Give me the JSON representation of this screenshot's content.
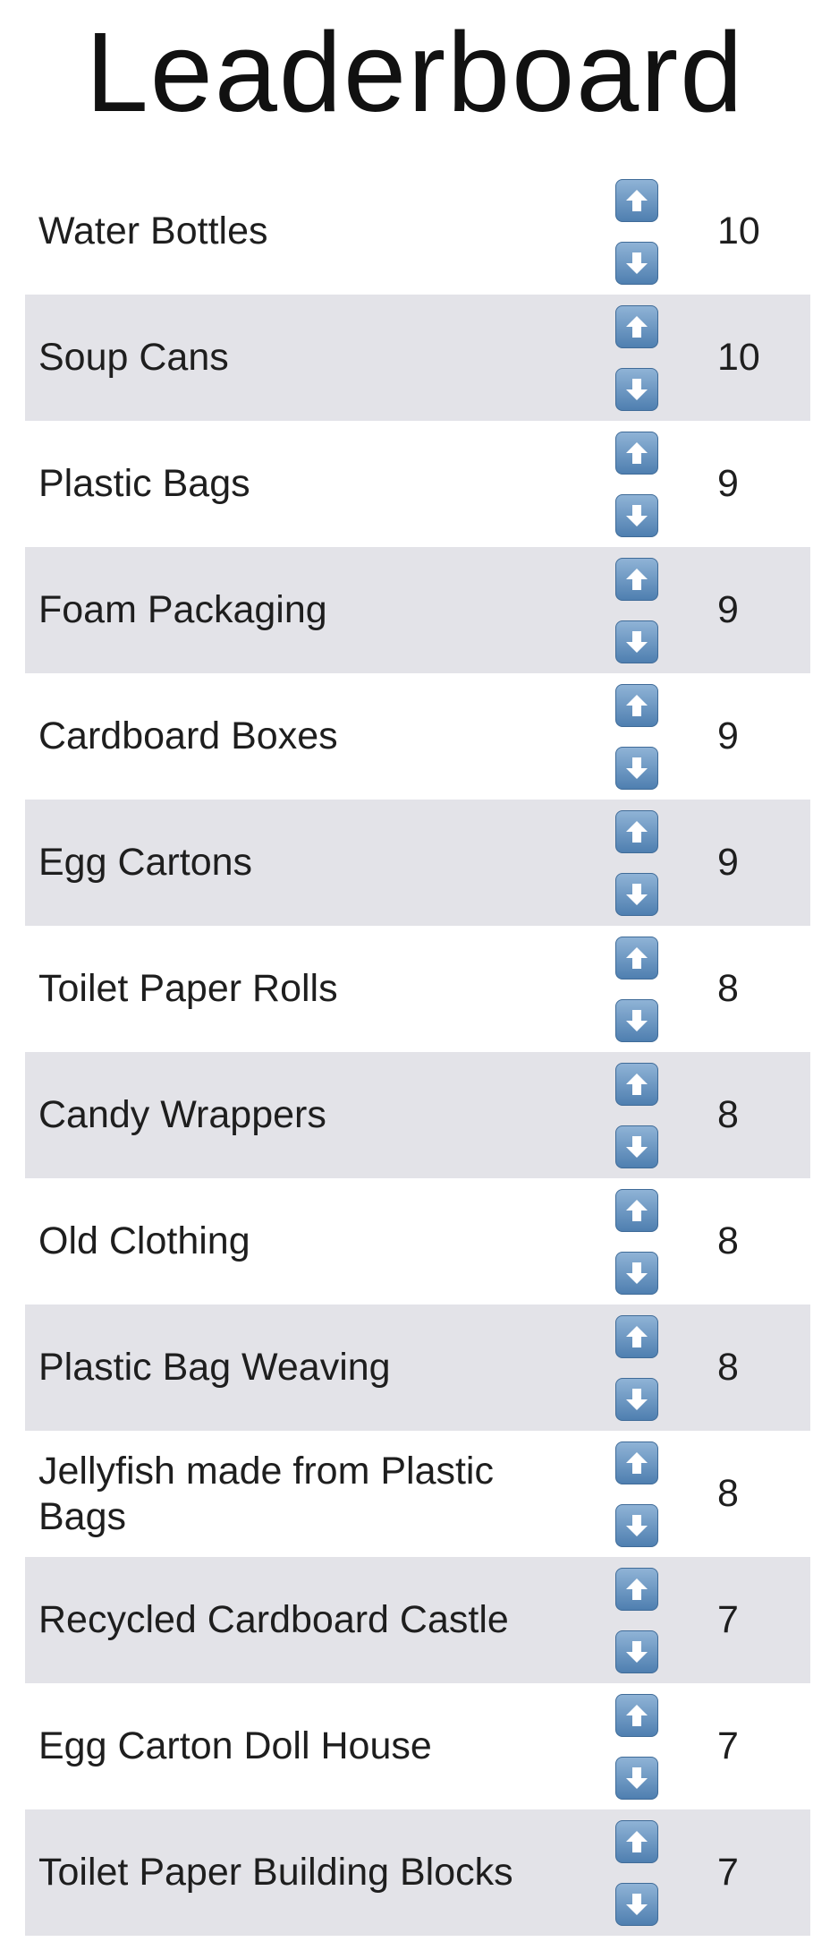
{
  "title": "Leaderboard",
  "items": [
    {
      "name": "Water Bottles",
      "score": "10"
    },
    {
      "name": "Soup Cans",
      "score": "10"
    },
    {
      "name": "Plastic Bags",
      "score": "9"
    },
    {
      "name": "Foam Packaging",
      "score": "9"
    },
    {
      "name": "Cardboard Boxes",
      "score": "9"
    },
    {
      "name": "Egg Cartons",
      "score": "9"
    },
    {
      "name": "Toilet Paper Rolls",
      "score": "8"
    },
    {
      "name": "Candy Wrappers",
      "score": "8"
    },
    {
      "name": "Old Clothing",
      "score": "8"
    },
    {
      "name": "Plastic Bag Weaving",
      "score": "8"
    },
    {
      "name": "Jellyfish made from Plastic Bags",
      "score": "8"
    },
    {
      "name": "Recycled Cardboard Castle",
      "score": "7"
    },
    {
      "name": "Egg Carton Doll House",
      "score": "7"
    },
    {
      "name": "Toilet Paper Building Blocks",
      "score": "7"
    }
  ],
  "icons": {
    "upvote": "upvote-arrow-icon",
    "downvote": "downvote-arrow-icon"
  },
  "colors": {
    "row_alt_bg": "#e3e3e8",
    "vote_button": "#5f8dbb"
  }
}
